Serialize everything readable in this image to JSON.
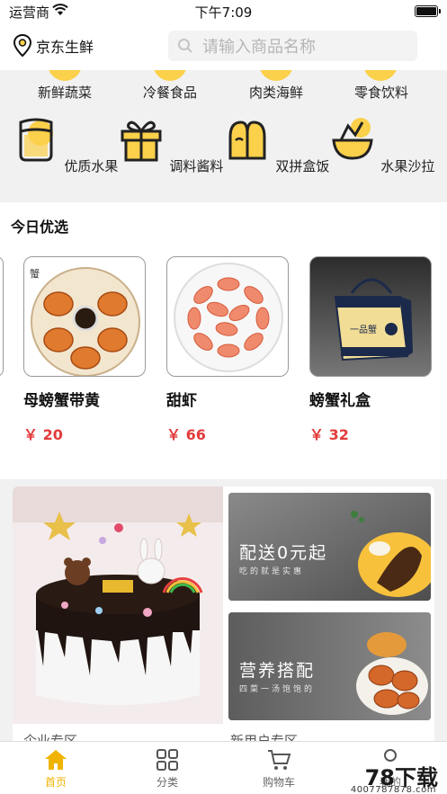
{
  "status": {
    "carrier": "运营商",
    "time": "下午7:09"
  },
  "header": {
    "location": "京东生鲜",
    "search_placeholder": "请输入商品名称"
  },
  "categories_row1": [
    "新鲜蔬菜",
    "冷餐食品",
    "肉类海鲜",
    "零食饮料"
  ],
  "categories_row2": [
    {
      "label": "优质水果",
      "icon": "fruit-basket-icon"
    },
    {
      "label": "调料酱料",
      "icon": "gift-box-icon"
    },
    {
      "label": "双拼盒饭",
      "icon": "bento-icon"
    },
    {
      "label": "水果沙拉",
      "icon": "salad-bowl-icon"
    }
  ],
  "today": {
    "title": "今日优选",
    "products": [
      {
        "name": "母螃蟹带黄",
        "price": "￥ 20"
      },
      {
        "name": "甜虾",
        "price": "￥ 66"
      },
      {
        "name": "螃蟹礼盒",
        "price": "￥ 32"
      }
    ]
  },
  "promo": {
    "banner1_title": "配送0元起",
    "banner1_sub": "吃的就是实惠",
    "banner2_title": "营养搭配",
    "banner2_sub": "四菜一汤饱饱的",
    "left_label": "企业专区",
    "right_label": "新用户专区"
  },
  "tabs": [
    {
      "label": "首页",
      "icon": "home-icon",
      "active": true
    },
    {
      "label": "分类",
      "icon": "grid-icon",
      "active": false
    },
    {
      "label": "购物车",
      "icon": "cart-icon",
      "active": false
    },
    {
      "label": "我的",
      "icon": "user-icon",
      "active": false
    }
  ],
  "watermark": {
    "text": "78下载",
    "url": "4007787878.com"
  },
  "colors": {
    "accent": "#f0b400",
    "icon_yellow": "#fbd04a",
    "price_red": "#e33b3b"
  }
}
